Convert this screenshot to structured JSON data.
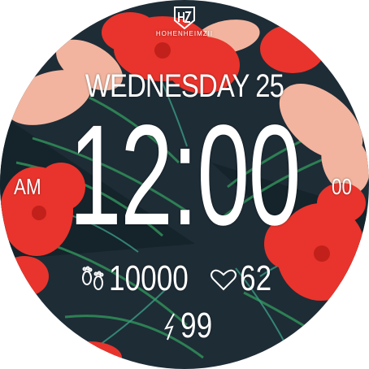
{
  "brand": {
    "name": "HOHENHEIMZII",
    "logo_icon": "hz-shield-logo-icon"
  },
  "date": {
    "label": "WEDNESDAY 25"
  },
  "time": {
    "value": "12:00",
    "period": "AM",
    "seconds": "00"
  },
  "stats": {
    "steps": {
      "icon": "footprints-icon",
      "value": "10000"
    },
    "heart_rate": {
      "icon": "heart-icon",
      "value": "62"
    },
    "battery": {
      "icon": "lightning-bolt-icon",
      "value": "99"
    }
  },
  "colors": {
    "text": "#ffffff",
    "hibiscus_red": "#e8342c",
    "petal_pink": "#f4b79f",
    "leaf_dark": "#1c2b33",
    "leaf_green": "#2e8a55",
    "leaf_teal": "#2f7f7a"
  }
}
